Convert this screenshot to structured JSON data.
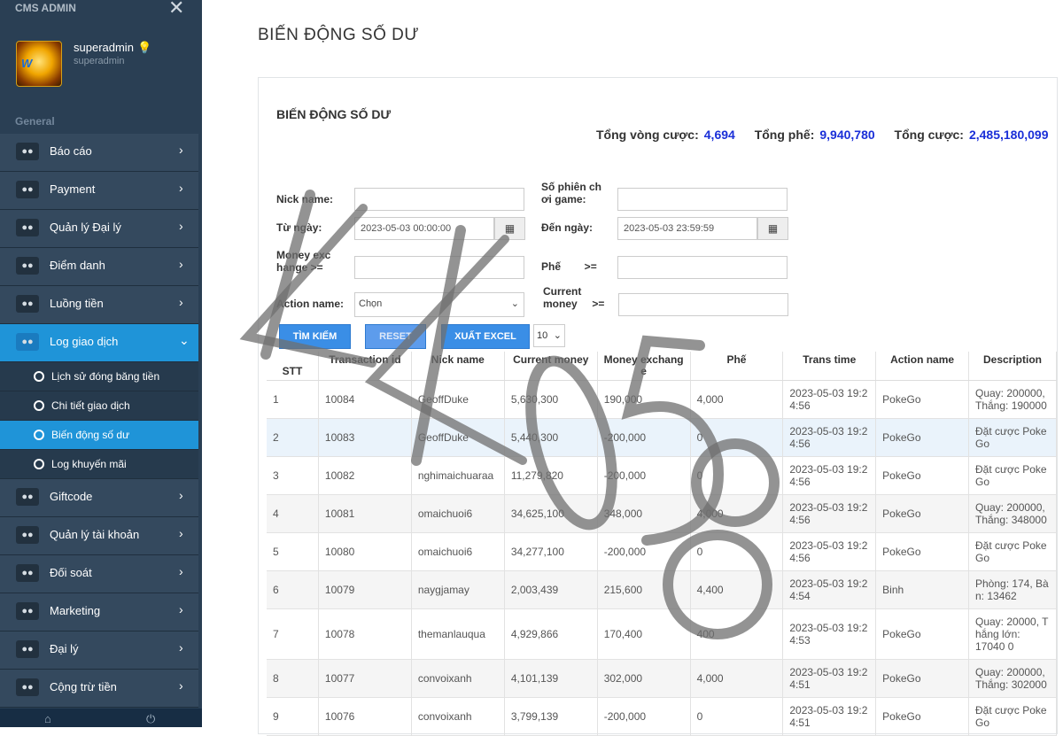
{
  "sidebar": {
    "app_title": "CMS ADMIN",
    "user_name": "superadmin",
    "user_sub": "superadmin",
    "section_label": "General",
    "items": [
      {
        "label": "Báo cáo"
      },
      {
        "label": "Payment"
      },
      {
        "label": "Quản lý Đại lý"
      },
      {
        "label": "Điểm danh"
      },
      {
        "label": "Luồng tiền"
      },
      {
        "label": "Log giao dịch"
      },
      {
        "label": "Giftcode"
      },
      {
        "label": "Quản lý tài khoản"
      },
      {
        "label": "Đối soát"
      },
      {
        "label": "Marketing"
      },
      {
        "label": "Đại lý"
      },
      {
        "label": "Cộng trừ tiền"
      }
    ],
    "sub_items": [
      {
        "label": "Lịch sử đóng băng tiền"
      },
      {
        "label": "Chi tiết giao dịch"
      },
      {
        "label": "Biến động số dư"
      },
      {
        "label": "Log khuyến mãi"
      }
    ]
  },
  "page": {
    "title": "BIẾN ĐỘNG SỐ DƯ",
    "panel_title": "BIẾN ĐỘNG SỐ DƯ"
  },
  "totals": {
    "vong_cuoc_label": "Tổng vòng cược:",
    "vong_cuoc_value": "4,694",
    "phe_label": "Tổng phế:",
    "phe_value": "9,940,780",
    "cuoc_label": "Tổng cược:",
    "cuoc_value": "2,485,180,099"
  },
  "filters": {
    "nick_name_label": "Nick name:",
    "so_phien_label_1": "Số phiên ch",
    "so_phien_label_2": "ơi game:",
    "tu_ngay_label": "Từ ngày:",
    "tu_ngay_value": "2023-05-03 00:00:00",
    "den_ngay_label": "Đến ngày:",
    "den_ngay_value": "2023-05-03 23:59:59",
    "money_exchange_label_1": "Money exc",
    "money_exchange_label_2": "hange  >=",
    "phe_label": "Phế        >=",
    "action_name_label": "Action name:",
    "action_name_value": "Chọn",
    "current_money_label_1": "Current",
    "current_money_label_2": "money     >="
  },
  "buttons": {
    "search": "TÌM KIẾM",
    "reset": "RESET",
    "export": "XUẤT EXCEL",
    "page_size": "10"
  },
  "table": {
    "headers": [
      "STT",
      "Transaction id",
      "Nick name",
      "Current money",
      "Money exchang e",
      "Phế",
      "Trans time",
      "Action name",
      "Description"
    ],
    "rows": [
      {
        "stt": "1",
        "tid": "10084",
        "nick": "GeoffDuke",
        "current": "5,630,300",
        "exchange": "190,000",
        "phe": "4,000",
        "time": "2023-05-03 19:2 4:56",
        "action": "PokeGo",
        "desc": "Quay: 200000, Thắng: 190000"
      },
      {
        "stt": "2",
        "tid": "10083",
        "nick": "GeoffDuke",
        "current": "5,440,300",
        "exchange": "-200,000",
        "phe": "0",
        "time": "2023-05-03 19:2 4:56",
        "action": "PokeGo",
        "desc": "Đặt cược Poke Go"
      },
      {
        "stt": "3",
        "tid": "10082",
        "nick": "nghimaichuaraa",
        "current": "11,279,820",
        "exchange": "-200,000",
        "phe": "0",
        "time": "2023-05-03 19:2 4:56",
        "action": "PokeGo",
        "desc": "Đặt cược Poke Go"
      },
      {
        "stt": "4",
        "tid": "10081",
        "nick": "omaichuoi6",
        "current": "34,625,100",
        "exchange": "348,000",
        "phe": "4,000",
        "time": "2023-05-03 19:2 4:56",
        "action": "PokeGo",
        "desc": "Quay: 200000, Thắng: 348000"
      },
      {
        "stt": "5",
        "tid": "10080",
        "nick": "omaichuoi6",
        "current": "34,277,100",
        "exchange": "-200,000",
        "phe": "0",
        "time": "2023-05-03 19:2 4:56",
        "action": "PokeGo",
        "desc": "Đặt cược Poke Go"
      },
      {
        "stt": "6",
        "tid": "10079",
        "nick": "naygjamay",
        "current": "2,003,439",
        "exchange": "215,600",
        "phe": "4,400",
        "time": "2023-05-03 19:2 4:54",
        "action": "Binh",
        "desc": "Phòng: 174, Bà n: 13462"
      },
      {
        "stt": "7",
        "tid": "10078",
        "nick": "themanlauqua",
        "current": "4,929,866",
        "exchange": "170,400",
        "phe": "400",
        "time": "2023-05-03 19:2 4:53",
        "action": "PokeGo",
        "desc": "Quay: 20000, T hắng lớn: 17040 0"
      },
      {
        "stt": "8",
        "tid": "10077",
        "nick": "convoixanh",
        "current": "4,101,139",
        "exchange": "302,000",
        "phe": "4,000",
        "time": "2023-05-03 19:2 4:51",
        "action": "PokeGo",
        "desc": "Quay: 200000, Thắng: 302000"
      },
      {
        "stt": "9",
        "tid": "10076",
        "nick": "convoixanh",
        "current": "3,799,139",
        "exchange": "-200,000",
        "phe": "0",
        "time": "2023-05-03 19:2 4:51",
        "action": "PokeGo",
        "desc": "Đặt cược Poke Go"
      }
    ]
  },
  "watermark": {
    "text": "KK058"
  },
  "colors": {
    "sidebar": "#2a3f54",
    "active": "#1f94d8",
    "accent_blue": "#1a2fd8",
    "button": "#3a8ee6"
  }
}
